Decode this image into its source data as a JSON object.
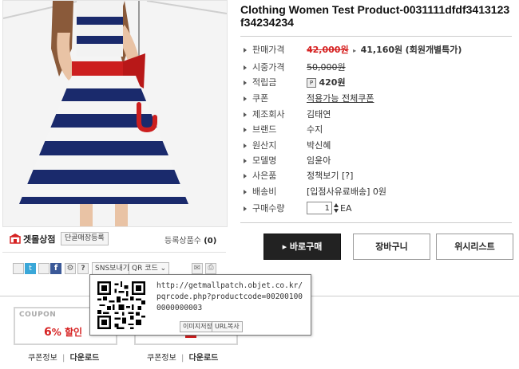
{
  "product": {
    "title": "Clothing Women Test Product-0031111dfdf3413123f34234234"
  },
  "info_rows": [
    {
      "label": "판매가격",
      "original": "42,000원",
      "sale": "41,160원",
      "note": "(회원개별특가)"
    },
    {
      "label": "시중가격",
      "value": "50,000원"
    },
    {
      "label": "적립금",
      "value": "420원"
    },
    {
      "label": "쿠폰",
      "value": "적용가능 전체쿠폰"
    },
    {
      "label": "제조회사",
      "value": "김태연"
    },
    {
      "label": "브랜드",
      "value": "수지"
    },
    {
      "label": "원산지",
      "value": "박신혜"
    },
    {
      "label": "모델명",
      "value": "임윤아"
    },
    {
      "label": "사은품",
      "value": "정책보기 [?]"
    },
    {
      "label": "배송비",
      "value": "[입점사유료배송] 0원"
    },
    {
      "label": "구매수량",
      "qty": "1",
      "unit": "EA"
    }
  ],
  "store": {
    "name": "겟몰상점",
    "button": "단골매장등록",
    "count_label": "등록상품수",
    "count": "(0)"
  },
  "social": {
    "sns_button": "SNS보내기",
    "qr_button": "QR 코드 ⌄"
  },
  "actions": {
    "buy": "▸ 바로구매",
    "cart": "장바구니",
    "wish": "위시리스트"
  },
  "coupons": [
    {
      "tag": "COUPON",
      "value_num": "6",
      "value_unit": "%",
      "value_suffix": " 할인",
      "info": "쿠폰정보",
      "download": "다운로드"
    },
    {
      "info": "쿠폰정보",
      "download": "다운로드"
    }
  ],
  "qr_popup": {
    "url": "http://getmallpatch.objet.co.kr/pqrcode.php?productcode=002001000000000003",
    "save_image": "이미지저장",
    "copy_url": "URL복사"
  },
  "colors": {
    "price_red": "#d62222",
    "buy_button": "#222222",
    "dress_navy": "#1a2a6c",
    "sash_red": "#cc1f1f"
  },
  "icons": [
    "store-logo-icon",
    "twitter-icon",
    "facebook-icon",
    "gear-icon",
    "help-icon",
    "mail-icon",
    "print-icon",
    "point-icon",
    "arrow-icon",
    "spinner-icon"
  ]
}
